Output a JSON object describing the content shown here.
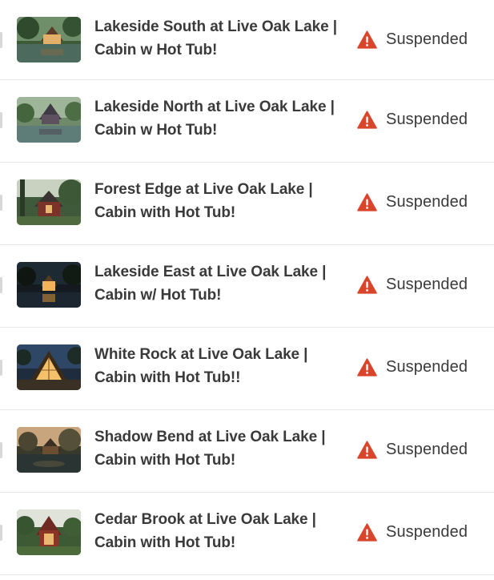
{
  "listings": [
    {
      "title": "Lakeside South at Live Oak Lake | Cabin w Hot Tub!",
      "status": "Suspended",
      "status_icon": "warning-triangle-icon"
    },
    {
      "title": "Lakeside North at Live Oak Lake | Cabin w Hot Tub!",
      "status": "Suspended",
      "status_icon": "warning-triangle-icon"
    },
    {
      "title": "Forest Edge at Live Oak Lake | Cabin with Hot Tub!",
      "status": "Suspended",
      "status_icon": "warning-triangle-icon"
    },
    {
      "title": "Lakeside East at Live Oak Lake | Cabin w/ Hot Tub!",
      "status": "Suspended",
      "status_icon": "warning-triangle-icon"
    },
    {
      "title": "White Rock at Live Oak Lake | Cabin with Hot Tub!!",
      "status": "Suspended",
      "status_icon": "warning-triangle-icon"
    },
    {
      "title": "Shadow Bend at Live Oak Lake | Cabin with Hot Tub!",
      "status": "Suspended",
      "status_icon": "warning-triangle-icon"
    },
    {
      "title": "Cedar Brook at Live Oak Lake | Cabin with Hot Tub!",
      "status": "Suspended",
      "status_icon": "warning-triangle-icon"
    }
  ],
  "colors": {
    "warning": "#d9452b",
    "text": "#3a3a3a",
    "divider": "#e6e6e6"
  }
}
